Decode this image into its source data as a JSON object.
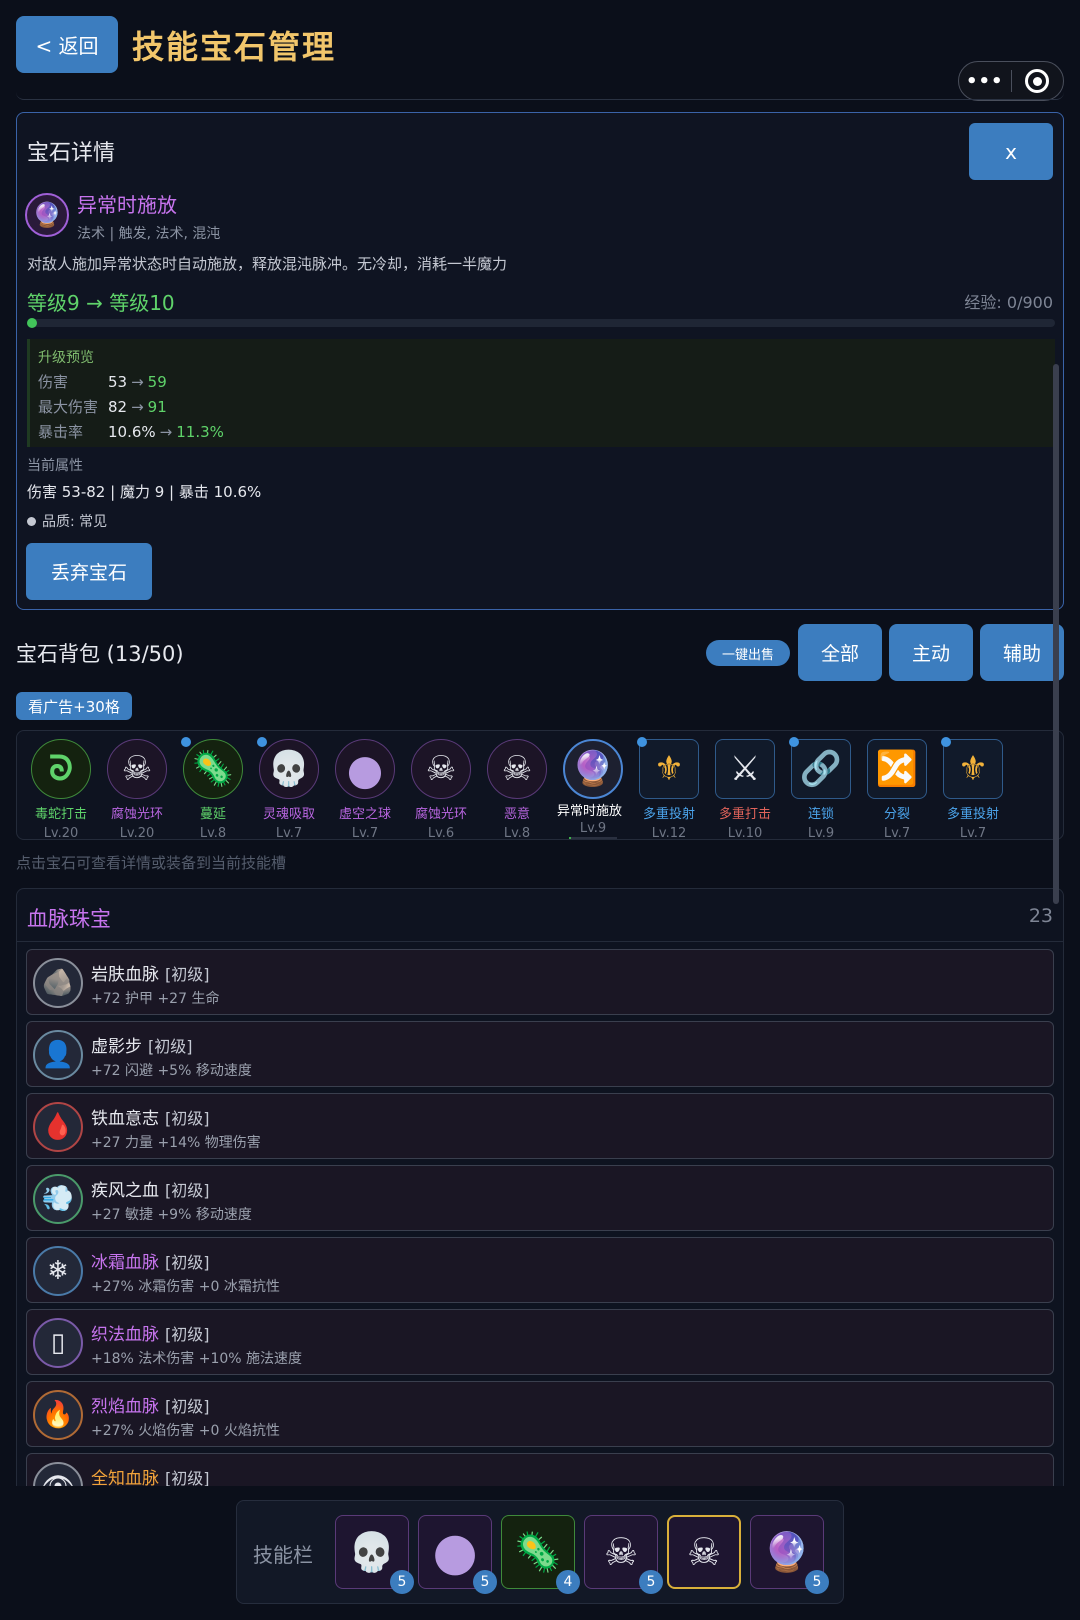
{
  "header": {
    "back_label": "< 返回",
    "title": "技能宝石管理",
    "menu_label": "•••"
  },
  "detail": {
    "title": "宝石详情",
    "close_label": "x",
    "gem_name": "异常时施放",
    "gem_tags": "法术 | 触发, 法术, 混沌",
    "gem_desc": "对敌人施加异常状态时自动施放，释放混沌脉冲。无冷却，消耗一半魔力",
    "level_text": "等级9 → 等级10",
    "exp_text": "经验: 0/900",
    "exp_progress": 0,
    "preview_title": "升级预览",
    "preview": [
      {
        "k": "伤害",
        "a": "53",
        "b": "59"
      },
      {
        "k": "最大伤害",
        "a": "82",
        "b": "91"
      },
      {
        "k": "暴击率",
        "a": "10.6%",
        "b": "11.3%"
      }
    ],
    "current_title": "当前属性",
    "current_attrs": "伤害 53-82 | 魔力 9 | 暴击 10.6%",
    "quality": "品质: 常见",
    "discard_label": "丢弃宝石"
  },
  "bag": {
    "title": "宝石背包 (13/50)",
    "sell_label": "一键出售",
    "filters": [
      "全部",
      "主动",
      "辅助"
    ],
    "ad_label": "看广告+30格",
    "hint": "点击宝石可查看详情或装备到当前技能槽",
    "gems": [
      {
        "name": "毒蛇打击",
        "lv": "Lv.20",
        "icon": "🐍",
        "glyph": "ᘐ",
        "shape": "circle green",
        "color": "#5fd36a",
        "exp": 0.95,
        "dot": false
      },
      {
        "name": "腐蚀光环",
        "lv": "Lv.20",
        "icon": "skull-crossbones-icon",
        "glyph": "☠",
        "shape": "circle",
        "color": "#b865e0",
        "exp": 0.95,
        "dot": false
      },
      {
        "name": "蔓延",
        "lv": "Lv.8",
        "icon": "microbe-icon",
        "glyph": "🦠",
        "shape": "circle green",
        "color": "#5fd36a",
        "exp": 0.05,
        "dot": true
      },
      {
        "name": "灵魂吸取",
        "lv": "Lv.7",
        "icon": "skull-icon",
        "glyph": "💀",
        "shape": "circle",
        "color": "#b865e0",
        "exp": 0.05,
        "dot": true
      },
      {
        "name": "虚空之球",
        "lv": "Lv.7",
        "icon": "purple-orb-icon",
        "glyph": "●",
        "shape": "circle",
        "color": "#b865e0",
        "exp": 0.05,
        "dot": false
      },
      {
        "name": "腐蚀光环",
        "lv": "Lv.6",
        "icon": "skull-crossbones-icon",
        "glyph": "☠",
        "shape": "circle",
        "color": "#b865e0",
        "exp": 0.05,
        "dot": false
      },
      {
        "name": "恶意",
        "lv": "Lv.8",
        "icon": "skull-crossbones-icon",
        "glyph": "☠",
        "shape": "circle",
        "color": "#b865e0",
        "exp": 0.05,
        "dot": false
      },
      {
        "name": "异常时施放",
        "lv": "Lv.9",
        "icon": "crystal-ball-icon",
        "glyph": "🔮",
        "shape": "circle sel",
        "color": "#ffffff",
        "exp": 0.05,
        "dot": false
      },
      {
        "name": "多重投射",
        "lv": "Lv.12",
        "icon": "fleur-icon",
        "glyph": "⚜",
        "shape": "square",
        "color": "#4ba3ea",
        "exp": 0.05,
        "dot": true
      },
      {
        "name": "多重打击",
        "lv": "Lv.10",
        "icon": "crossed-swords-icon",
        "glyph": "⚔",
        "shape": "square",
        "color": "#e0635a",
        "exp": 0.05,
        "dot": false
      },
      {
        "name": "连锁",
        "lv": "Lv.9",
        "icon": "link-icon",
        "glyph": "🔗",
        "shape": "square",
        "color": "#4ba3ea",
        "exp": 0.05,
        "dot": true
      },
      {
        "name": "分裂",
        "lv": "Lv.7",
        "icon": "shuffle-icon",
        "glyph": "🔀",
        "shape": "square",
        "color": "#4ba3ea",
        "exp": 0.05,
        "dot": false
      },
      {
        "name": "多重投射",
        "lv": "Lv.7",
        "icon": "fleur-icon",
        "glyph": "⚜",
        "shape": "square",
        "color": "#4ba3ea",
        "exp": 0.05,
        "dot": true
      }
    ]
  },
  "bloodline": {
    "title": "血脉珠宝",
    "count": "23",
    "items": [
      {
        "name": "岩肤血脉",
        "tier": "[初级]",
        "stat": "+72 护甲  +27 生命",
        "icon": "rock-icon",
        "glyph": "🪨",
        "color": "#e6e8ee",
        "ring": "#8a8f9a"
      },
      {
        "name": "虚影步",
        "tier": "[初级]",
        "stat": "+72 闪避  +5% 移动速度",
        "icon": "silhouette-icon",
        "glyph": "👤",
        "color": "#e6e8ee",
        "ring": "#6a8aa0"
      },
      {
        "name": "铁血意志",
        "tier": "[初级]",
        "stat": "+27 力量  +14% 物理伤害",
        "icon": "blood-drop-icon",
        "glyph": "🩸",
        "color": "#e6e8ee",
        "ring": "#b04545"
      },
      {
        "name": "疾风之血",
        "tier": "[初级]",
        "stat": "+27 敏捷  +9% 移动速度",
        "icon": "wind-icon",
        "glyph": "💨",
        "color": "#e6e8ee",
        "ring": "#4a9a6a"
      },
      {
        "name": "冰霜血脉",
        "tier": "[初级]",
        "stat": "+27% 冰霜伤害  +0 冰霜抗性",
        "icon": "snowflake-icon",
        "glyph": "❄",
        "color": "#c774ee",
        "ring": "#4a7aa8"
      },
      {
        "name": "织法血脉",
        "tier": "[初级]",
        "stat": "+18% 法术伤害  +10% 施法速度",
        "icon": "weave-icon",
        "glyph": "▯",
        "color": "#c774ee",
        "ring": "#7a5aa8"
      },
      {
        "name": "烈焰血脉",
        "tier": "[初级]",
        "stat": "+27% 火焰伤害  +0 火焰抗性",
        "icon": "fire-icon",
        "glyph": "🔥",
        "color": "#c774ee",
        "ring": "#b06a35"
      },
      {
        "name": "全知血脉",
        "tier": "[初级]",
        "stat": "",
        "icon": "eye-icon",
        "glyph": "👁",
        "color": "#f2a33a",
        "ring": "#8a8f9a"
      }
    ]
  },
  "skillbar": {
    "label": "技能栏",
    "slots": [
      {
        "icon": "skull-icon",
        "glyph": "💀",
        "num": "5",
        "style": "",
        "active": false
      },
      {
        "icon": "purple-orb-icon",
        "glyph": "●",
        "num": "5",
        "style": "",
        "active": false
      },
      {
        "icon": "microbe-icon",
        "glyph": "🦠",
        "num": "4",
        "style": "green",
        "active": false
      },
      {
        "icon": "skull-crossbones-icon",
        "glyph": "☠",
        "num": "5",
        "style": "",
        "active": false
      },
      {
        "icon": "skull-crossbones-icon",
        "glyph": "☠",
        "num": "",
        "style": "",
        "active": true
      },
      {
        "icon": "crystal-ball-icon",
        "glyph": "🔮",
        "num": "5",
        "style": "",
        "active": false
      }
    ]
  },
  "colors": {
    "accent": "#3c7dbf",
    "title": "#f2c66b",
    "purple": "#c774ee",
    "green": "#5fd36a"
  }
}
